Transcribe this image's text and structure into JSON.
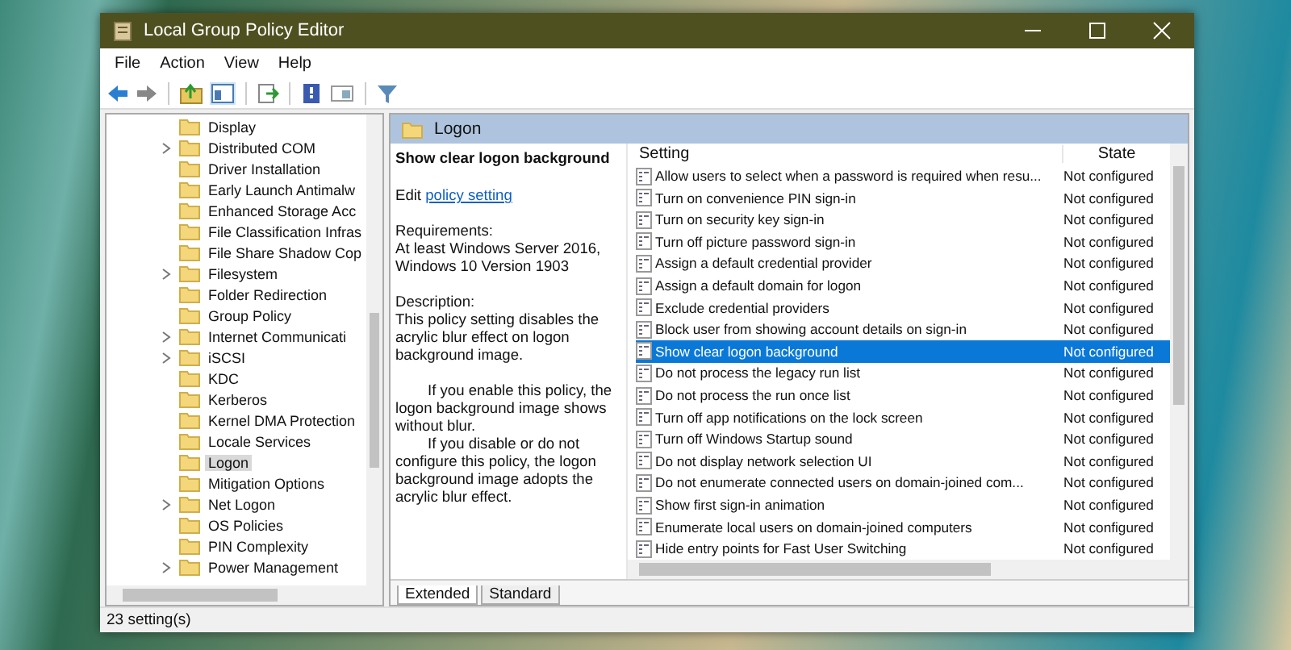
{
  "window": {
    "title": "Local Group Policy Editor"
  },
  "menu": [
    "File",
    "Action",
    "View",
    "Help"
  ],
  "tree": {
    "items": [
      {
        "label": "Display",
        "expandable": false,
        "selected": false
      },
      {
        "label": "Distributed COM",
        "expandable": true,
        "selected": false
      },
      {
        "label": "Driver Installation",
        "expandable": false,
        "selected": false
      },
      {
        "label": "Early Launch Antimalw",
        "expandable": false,
        "selected": false
      },
      {
        "label": "Enhanced Storage Acc",
        "expandable": false,
        "selected": false
      },
      {
        "label": "File Classification Infras",
        "expandable": false,
        "selected": false
      },
      {
        "label": "File Share Shadow Cop",
        "expandable": false,
        "selected": false
      },
      {
        "label": "Filesystem",
        "expandable": true,
        "selected": false
      },
      {
        "label": "Folder Redirection",
        "expandable": false,
        "selected": false
      },
      {
        "label": "Group Policy",
        "expandable": false,
        "selected": false
      },
      {
        "label": "Internet Communicati",
        "expandable": true,
        "selected": false
      },
      {
        "label": "iSCSI",
        "expandable": true,
        "selected": false
      },
      {
        "label": "KDC",
        "expandable": false,
        "selected": false
      },
      {
        "label": "Kerberos",
        "expandable": false,
        "selected": false
      },
      {
        "label": "Kernel DMA Protection",
        "expandable": false,
        "selected": false
      },
      {
        "label": "Locale Services",
        "expandable": false,
        "selected": false
      },
      {
        "label": "Logon",
        "expandable": false,
        "selected": true
      },
      {
        "label": "Mitigation Options",
        "expandable": false,
        "selected": false
      },
      {
        "label": "Net Logon",
        "expandable": true,
        "selected": false
      },
      {
        "label": "OS Policies",
        "expandable": false,
        "selected": false
      },
      {
        "label": "PIN Complexity",
        "expandable": false,
        "selected": false
      },
      {
        "label": "Power Management",
        "expandable": true,
        "selected": false
      }
    ]
  },
  "details": {
    "header": "Logon",
    "title": "Show clear logon background",
    "edit_prefix": "Edit",
    "edit_link": "policy setting",
    "requirements_label": "Requirements:",
    "requirements": "At least Windows Server 2016, Windows 10 Version 1903",
    "description_label": "Description:",
    "description": [
      "This policy setting disables the acrylic blur effect on logon background image.",
      "If you enable this policy, the logon background image shows without blur.",
      "If you disable or do not configure this policy, the logon background image adopts the acrylic blur effect."
    ]
  },
  "table": {
    "columns": [
      "Setting",
      "State"
    ],
    "rows": [
      {
        "setting": "Allow users to select when a password is required when resu...",
        "state": "Not configured",
        "selected": false
      },
      {
        "setting": "Turn on convenience PIN sign-in",
        "state": "Not configured",
        "selected": false
      },
      {
        "setting": "Turn on security key sign-in",
        "state": "Not configured",
        "selected": false
      },
      {
        "setting": "Turn off picture password sign-in",
        "state": "Not configured",
        "selected": false
      },
      {
        "setting": "Assign a default credential provider",
        "state": "Not configured",
        "selected": false
      },
      {
        "setting": "Assign a default domain for logon",
        "state": "Not configured",
        "selected": false
      },
      {
        "setting": "Exclude credential providers",
        "state": "Not configured",
        "selected": false
      },
      {
        "setting": "Block user from showing account details on sign-in",
        "state": "Not configured",
        "selected": false
      },
      {
        "setting": "Show clear logon background",
        "state": "Not configured",
        "selected": true
      },
      {
        "setting": "Do not process the legacy run list",
        "state": "Not configured",
        "selected": false
      },
      {
        "setting": "Do not process the run once list",
        "state": "Not configured",
        "selected": false
      },
      {
        "setting": "Turn off app notifications on the lock screen",
        "state": "Not configured",
        "selected": false
      },
      {
        "setting": "Turn off Windows Startup sound",
        "state": "Not configured",
        "selected": false
      },
      {
        "setting": "Do not display network selection UI",
        "state": "Not configured",
        "selected": false
      },
      {
        "setting": "Do not enumerate connected users on domain-joined com...",
        "state": "Not configured",
        "selected": false
      },
      {
        "setting": "Show first sign-in animation",
        "state": "Not configured",
        "selected": false
      },
      {
        "setting": "Enumerate local users on domain-joined computers",
        "state": "Not configured",
        "selected": false
      },
      {
        "setting": "Hide entry points for Fast User Switching",
        "state": "Not configured",
        "selected": false
      }
    ]
  },
  "view_tabs": [
    {
      "label": "Extended",
      "selected": true
    },
    {
      "label": "Standard",
      "selected": false
    }
  ],
  "status_bar": "23 setting(s)"
}
